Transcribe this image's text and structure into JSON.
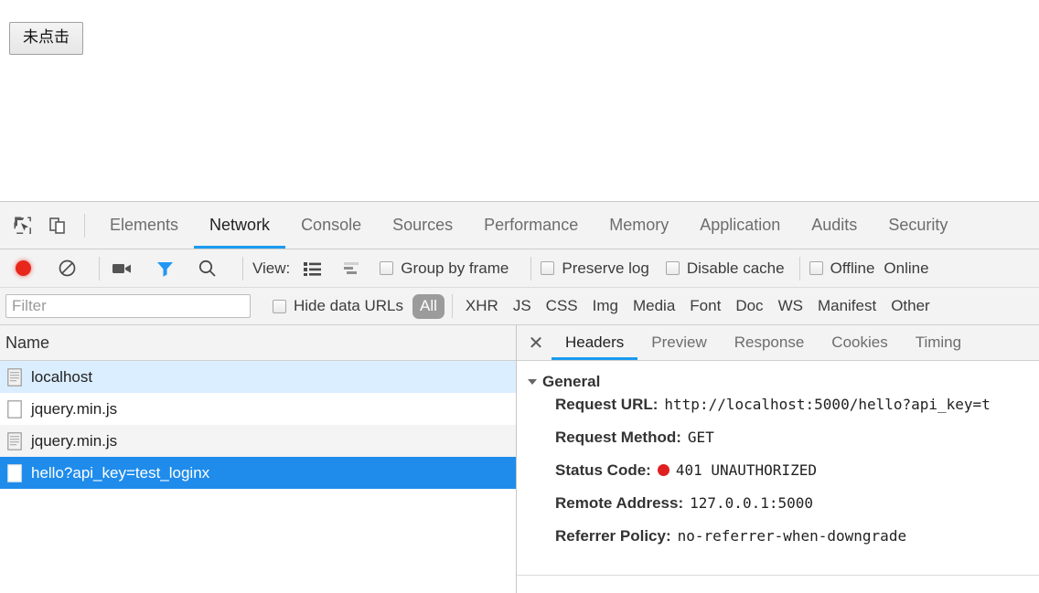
{
  "page": {
    "button_label": "未点击"
  },
  "devtools": {
    "inspect_icon": "inspect-cursor-icon",
    "device_icon": "device-toolbar-icon",
    "tabs": [
      {
        "label": "Elements",
        "active": false
      },
      {
        "label": "Network",
        "active": true
      },
      {
        "label": "Console",
        "active": false
      },
      {
        "label": "Sources",
        "active": false
      },
      {
        "label": "Performance",
        "active": false
      },
      {
        "label": "Memory",
        "active": false
      },
      {
        "label": "Application",
        "active": false
      },
      {
        "label": "Audits",
        "active": false
      },
      {
        "label": "Security",
        "active": false
      }
    ],
    "accent_color": "#1a9bf0",
    "toolbar": {
      "record_title": "record-button",
      "clear_title": "clear-button",
      "camera_title": "capture-screenshots-button",
      "filter_title": "filter-button",
      "search_title": "search-button",
      "view_label": "View:",
      "checkboxes": [
        {
          "label": "Group by frame",
          "checked": false
        },
        {
          "label": "Preserve log",
          "checked": false
        },
        {
          "label": "Disable cache",
          "checked": false
        },
        {
          "label": "Offline",
          "checked": false
        }
      ],
      "throttling_value": "Online",
      "filter_accent": "#2196f3",
      "record_color": "#e8271c"
    },
    "filterbar": {
      "filter_placeholder": "Filter",
      "filter_value": "",
      "hide_data_urls_label": "Hide data URLs",
      "hide_data_urls_checked": false,
      "all_label": "All",
      "types": [
        "XHR",
        "JS",
        "CSS",
        "Img",
        "Media",
        "Font",
        "Doc",
        "WS",
        "Manifest",
        "Other"
      ]
    },
    "requests": {
      "column_header": "Name",
      "rows": [
        {
          "name": "localhost",
          "icon": "document-icon",
          "state": "hovered"
        },
        {
          "name": "jquery.min.js",
          "icon": "blank-document-icon",
          "state": "normal"
        },
        {
          "name": "jquery.min.js",
          "icon": "document-icon",
          "state": "alt"
        },
        {
          "name": "hello?api_key=test_loginx",
          "icon": "blank-document-icon",
          "state": "selected"
        }
      ],
      "selected_color": "#1f8ceb",
      "hover_color": "#dbeeff"
    },
    "detail": {
      "close_icon": "close-icon",
      "tabs": [
        {
          "label": "Headers",
          "active": true
        },
        {
          "label": "Preview",
          "active": false
        },
        {
          "label": "Response",
          "active": false
        },
        {
          "label": "Cookies",
          "active": false
        },
        {
          "label": "Timing",
          "active": false
        }
      ],
      "section_title": "General",
      "rows": [
        {
          "key": "Request URL:",
          "value": "http://localhost:5000/hello?api_key=t"
        },
        {
          "key": "Request Method:",
          "value": "GET"
        },
        {
          "key": "Status Code:",
          "value": "401 UNAUTHORIZED",
          "status_dot": "#e02020"
        },
        {
          "key": "Remote Address:",
          "value": "127.0.0.1:5000"
        },
        {
          "key": "Referrer Policy:",
          "value": "no-referrer-when-downgrade"
        }
      ]
    }
  }
}
